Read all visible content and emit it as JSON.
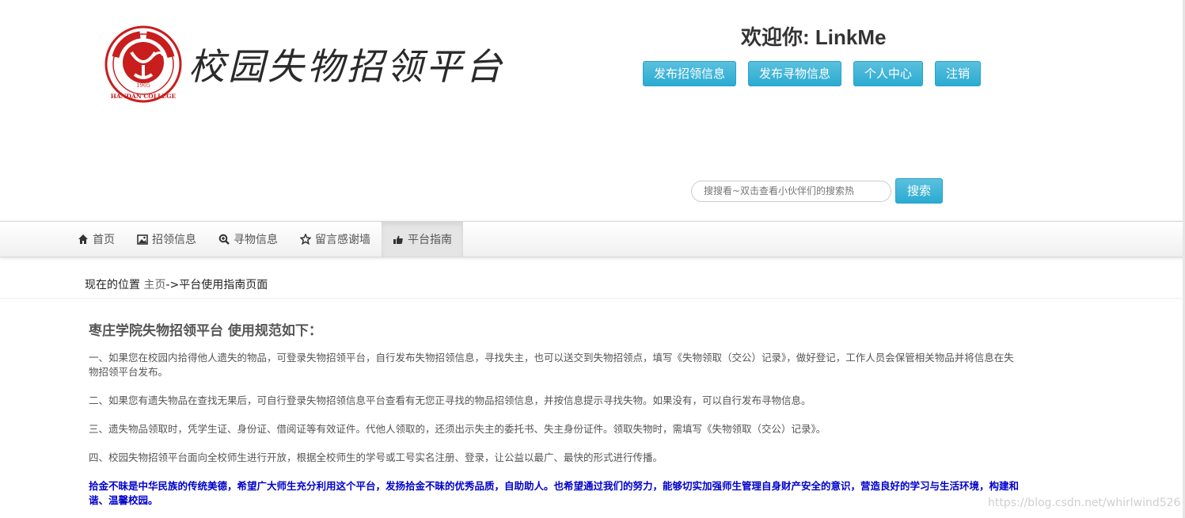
{
  "header": {
    "brand_title": "校园失物招领平台",
    "seal_text": "HANDAN COLLEGE",
    "seal_year": "1905",
    "welcome": "欢迎你: LinkMe",
    "buttons": [
      "发布招领信息",
      "发布寻物信息",
      "个人中心",
      "注销"
    ]
  },
  "search": {
    "placeholder": "搜搜看~双击查看小伙伴们的搜索热",
    "button": "搜索"
  },
  "nav": {
    "items": [
      {
        "label": "首页",
        "icon": "home-icon"
      },
      {
        "label": "招领信息",
        "icon": "picture-icon"
      },
      {
        "label": "寻物信息",
        "icon": "zoom-icon"
      },
      {
        "label": "留言感谢墙",
        "icon": "star-icon"
      },
      {
        "label": "平台指南",
        "icon": "hand-pointer-icon"
      }
    ],
    "active_index": 4
  },
  "breadcrumb": {
    "prefix": "现在的位置 ",
    "home": "主页",
    "current": "->平台使用指南页面"
  },
  "content": {
    "title": "枣庄学院失物招领平台 使用规范如下：",
    "paragraphs": [
      "一、如果您在校园内拾得他人遗失的物品，可登录失物招领平台，自行发布失物招领信息，寻找失主，也可以送交到失物招领点，填写《失物领取（交公）记录》，做好登记，工作人员会保管相关物品并将信息在失物招领平台发布。",
      "二、如果您有遗失物品在查找无果后，可自行登录失物招领信息平台查看有无您正寻找的物品招领信息，并按信息提示寻找失物。如果没有，可以自行发布寻物信息。",
      "三、遗失物品领取时，凭学生证、身份证、借阅证等有效证件。代他人领取的，还须出示失主的委托书、失主身份证件。领取失物时，需填写《失物领取（交公）记录》。",
      "四、校园失物招领平台面向全校师生进行开放，根据全校师生的学号或工号实名注册、登录，让公益以最广、最快的形式进行传播。"
    ],
    "closing": "拾金不昧是中华民族的传统美德，希望广大师生充分利用这个平台，发扬拾金不昧的优秀品质，自助助人。也希望通过我们的努力，能够切实加强师生管理自身财产安全的意识，营造良好的学习与生活环境，构建和谐、温馨校园。"
  },
  "watermark": "https://blog.csdn.net/whirlwind526",
  "colors": {
    "button": "#31b0d5",
    "closing_text": "#0000cc"
  }
}
